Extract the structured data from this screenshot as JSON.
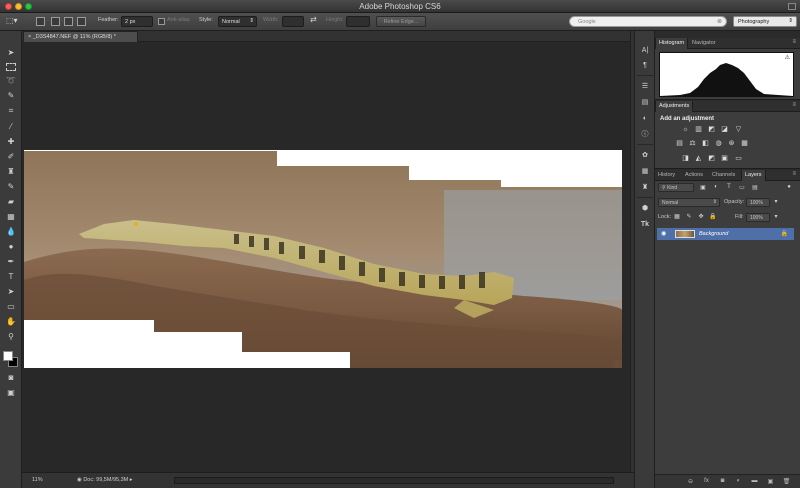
{
  "app": {
    "title": "Adobe Photoshop CS6"
  },
  "options": {
    "feather_label": "Feather:",
    "feather_value": "2 px",
    "antialias_label": "Anti-alias",
    "style_label": "Style:",
    "style_value": "Normal",
    "width_label": "Width:",
    "height_label": "Height:",
    "refine_edge": "Refine Edge..."
  },
  "search": {
    "placeholder": "Google"
  },
  "workspace": {
    "value": "Photography"
  },
  "document": {
    "tab": "_D3S4847.NEF @ 11% (RGB/8) *",
    "zoom": "11%",
    "doc_info": "Doc: 99,5M/95,3M"
  },
  "panels": {
    "histogram_tab": "Histogram",
    "navigator_tab": "Navigator",
    "adjustments_tab": "Adjustments",
    "add_adjustment": "Add an adjustment",
    "layer_tabs": [
      "History",
      "Actions",
      "Channels",
      "Layers"
    ],
    "kind": "Kind",
    "blend_mode": "Normal",
    "opacity_label": "Opacity:",
    "opacity_value": "100%",
    "lock_label": "Lock:",
    "fill_label": "Fill:",
    "fill_value": "100%",
    "layer_name": "Background"
  },
  "colors": {
    "foreground": "#ffffff",
    "background": "#000000",
    "layer_selected": "#4f6fa8"
  }
}
